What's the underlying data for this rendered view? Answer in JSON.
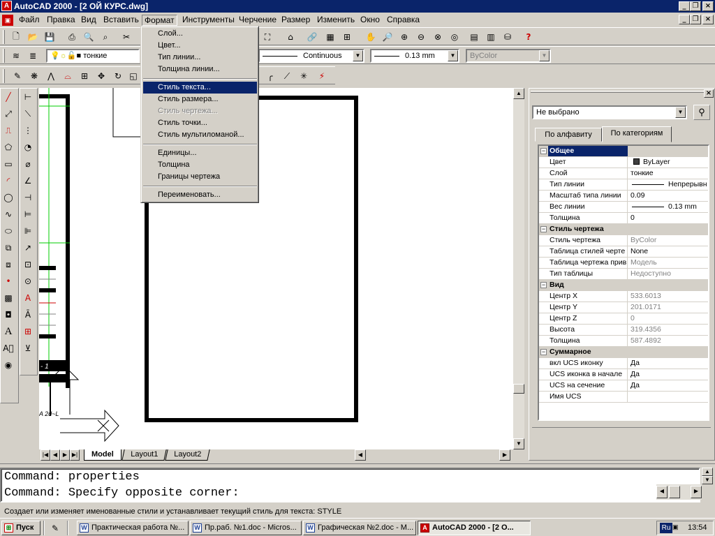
{
  "window": {
    "title": "AutoCAD 2000 - [2 ОЙ КУРС.dwg]"
  },
  "menubar": [
    "Файл",
    "Правка",
    "Вид",
    "Вставить",
    "Формат",
    "Инструменты",
    "Черчение",
    "Размер",
    "Изменить",
    "Окно",
    "Справка"
  ],
  "format_menu": {
    "group1": [
      "Слой...",
      "Цвет...",
      "Тип линии...",
      "Толщина линии..."
    ],
    "group2": [
      "Стиль текста...",
      "Стиль размера...",
      "Стиль чертежа...",
      "Стиль точки...",
      "Стиль мультиломаной..."
    ],
    "group3": [
      "Единицы...",
      "Толщина",
      "Границы чертежа"
    ],
    "group4": [
      "Переименовать..."
    ],
    "highlighted": "Стиль текста...",
    "disabled": "Стиль чертежа..."
  },
  "layer_toolbar": {
    "layer": "тонкие",
    "linetype": "Continuous",
    "lineweight": "0.13 mm",
    "plotstyle": "ByColor"
  },
  "tabs": {
    "model": "Model",
    "layout1": "Layout1",
    "layout2": "Layout2"
  },
  "properties": {
    "selection": "Не выбрано",
    "tab_alpha": "По алфавиту",
    "tab_cat": "По категориям",
    "categories": [
      {
        "name": "Общее",
        "rows": [
          {
            "k": "Цвет",
            "v": "ByLayer"
          },
          {
            "k": "Слой",
            "v": "тонкие"
          },
          {
            "k": "Тип линии",
            "v": "Непрерывн"
          },
          {
            "k": "Масштаб типа линии",
            "v": "0.09"
          },
          {
            "k": "Вес линии",
            "v": "0.13 mm"
          },
          {
            "k": "Толщина",
            "v": "0"
          }
        ]
      },
      {
        "name": "Стиль чертежа",
        "rows": [
          {
            "k": "Стиль чертежа",
            "v": "ByColor"
          },
          {
            "k": "Таблица стилей черте",
            "v": "None"
          },
          {
            "k": "Таблица чертежа прив",
            "v": "Модель"
          },
          {
            "k": "Тип таблицы",
            "v": "Недоступно"
          }
        ]
      },
      {
        "name": "Вид",
        "rows": [
          {
            "k": "Центр X",
            "v": "533.6013"
          },
          {
            "k": "Центр Y",
            "v": "201.0171"
          },
          {
            "k": "Центр Z",
            "v": "0"
          },
          {
            "k": "Высота",
            "v": "319.4356"
          },
          {
            "k": "Толщина",
            "v": "587.4892"
          }
        ]
      },
      {
        "name": "Суммарное",
        "rows": [
          {
            "k": "вкл UCS иконку",
            "v": "Да"
          },
          {
            "k": "UCS иконка в начале",
            "v": "Да"
          },
          {
            "k": "UCS на сечение",
            "v": "Да"
          },
          {
            "k": "Имя UCS",
            "v": ""
          }
        ]
      }
    ]
  },
  "command": {
    "line1": "Command: properties",
    "line2": "Command: Specify opposite corner:"
  },
  "statusbar": "Создает или изменяет именованные стили и устанавливает текущий стиль для текста:  STYLE",
  "taskbar": {
    "start": "Пуск",
    "tasks": [
      "Практическая работа №...",
      "Пр.раб. №1.doc - Micros...",
      "Графическая №2.doc - M...",
      "AutoCAD 2000 - [2 О..."
    ],
    "lang": "Ru",
    "clock": "13:54"
  },
  "colors": {
    "titlebar": "#0a246a",
    "face": "#d4d0c8",
    "highlight": "#0a246a"
  }
}
